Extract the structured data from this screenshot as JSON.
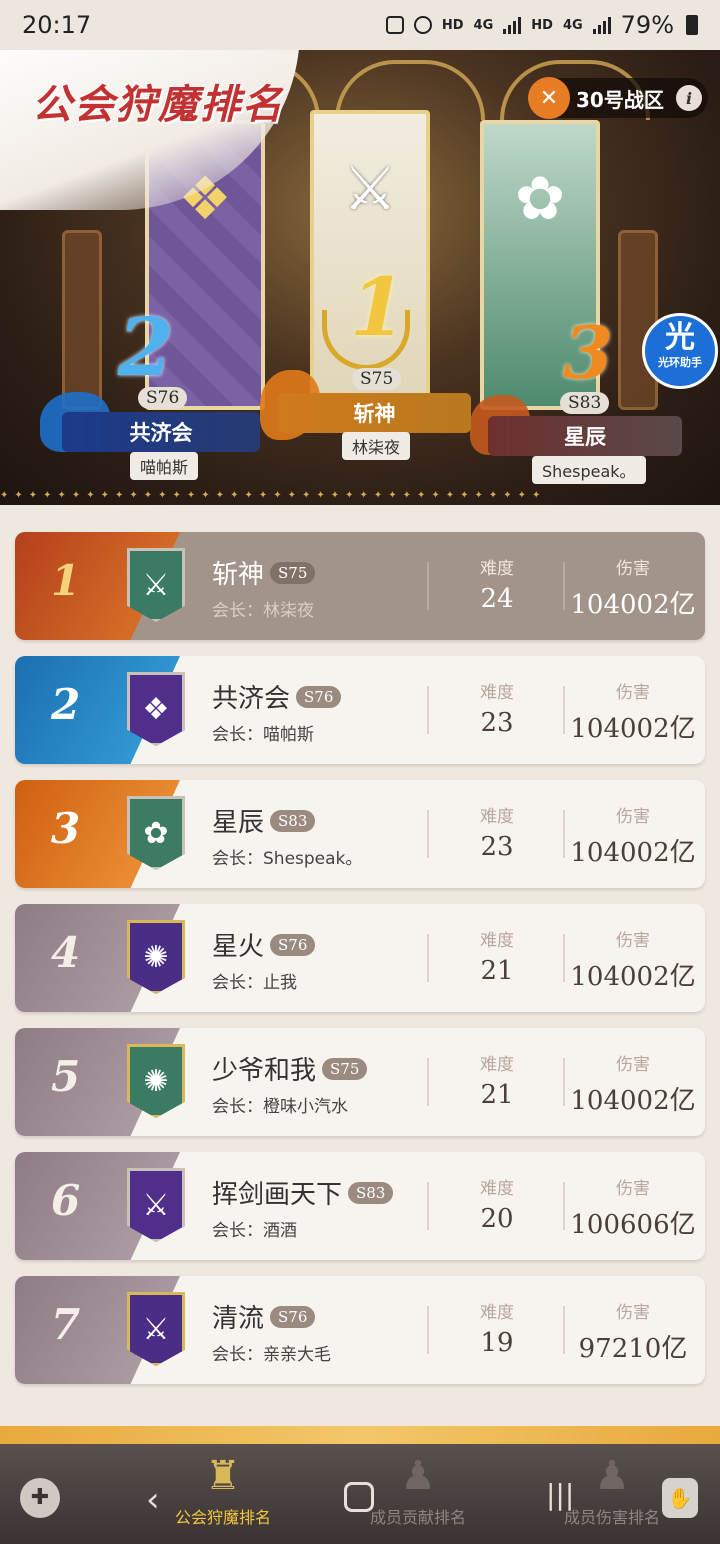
{
  "status_bar": {
    "time": "20:17",
    "hd1": "HD",
    "net1": "4G",
    "hd2": "HD",
    "net2": "4G",
    "battery": "79%"
  },
  "header": {
    "title": "公会狩魔排名",
    "zone": "30号战区",
    "info_icon": "i"
  },
  "assistant": {
    "label_big": "光",
    "label_small": "光环助手"
  },
  "podium": [
    {
      "rank": "1",
      "season": "S75",
      "guild": "斩神",
      "leader": "林柒夜"
    },
    {
      "rank": "2",
      "season": "S76",
      "guild": "共济会",
      "leader": "喵帕斯"
    },
    {
      "rank": "3",
      "season": "S83",
      "guild": "星辰",
      "leader": "Shespeak。"
    }
  ],
  "columns": {
    "difficulty": "难度",
    "damage": "伤害"
  },
  "rows": [
    {
      "rank": "1",
      "guild": "斩神",
      "season": "S75",
      "leader": "会长：林柒夜",
      "difficulty": "24",
      "damage": "104002亿"
    },
    {
      "rank": "2",
      "guild": "共济会",
      "season": "S76",
      "leader": "会长：喵帕斯",
      "difficulty": "23",
      "damage": "104002亿"
    },
    {
      "rank": "3",
      "guild": "星辰",
      "season": "S83",
      "leader": "会长：Shespeak。",
      "difficulty": "23",
      "damage": "104002亿"
    },
    {
      "rank": "4",
      "guild": "星火",
      "season": "S76",
      "leader": "会长：止我",
      "difficulty": "21",
      "damage": "104002亿"
    },
    {
      "rank": "5",
      "guild": "少爷和我",
      "season": "S75",
      "leader": "会长：橙味小汽水",
      "difficulty": "21",
      "damage": "104002亿"
    },
    {
      "rank": "6",
      "guild": "挥剑画天下",
      "season": "S83",
      "leader": "会长：酒酒",
      "difficulty": "20",
      "damage": "100606亿"
    },
    {
      "rank": "7",
      "guild": "清流",
      "season": "S76",
      "leader": "会长：亲亲大毛",
      "difficulty": "19",
      "damage": "97210亿"
    }
  ],
  "bottom_nav": {
    "tabs": [
      {
        "label": "公会狩魔排名",
        "icon": "throne-icon",
        "active": true
      },
      {
        "label": "成员贡献排名",
        "icon": "hooded-figure-icon",
        "active": false
      },
      {
        "label": "成员伤害排名",
        "icon": "hooded-figure-icon",
        "active": false
      }
    ]
  },
  "colors": {
    "rank1": "#c95a1e",
    "rank2": "#2a86c5",
    "rank3": "#e07a1a",
    "rank_other": "#9c8a94",
    "accent": "#f3c640"
  }
}
